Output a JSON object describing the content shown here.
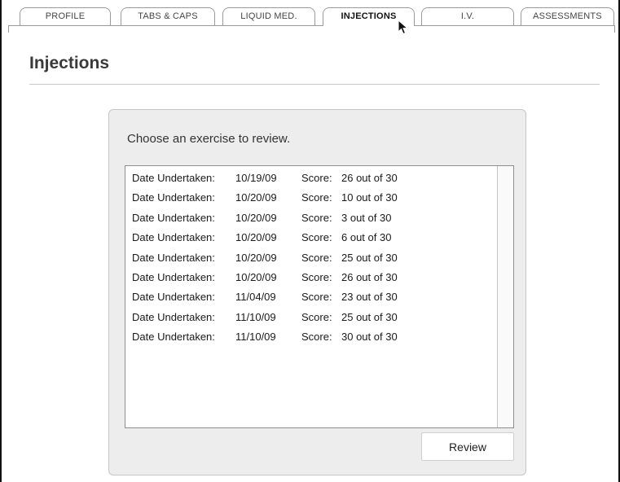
{
  "tabs": [
    {
      "label": "PROFILE",
      "active": false
    },
    {
      "label": "TABS & CAPS",
      "active": false
    },
    {
      "label": "LIQUID MED.",
      "active": false
    },
    {
      "label": "INJECTIONS",
      "active": true
    },
    {
      "label": "I.V.",
      "active": false
    },
    {
      "label": "ASSESSMENTS",
      "active": false
    }
  ],
  "page": {
    "title": "Injections"
  },
  "panel": {
    "prompt": "Choose an exercise to review.",
    "review_label": "Review"
  },
  "exercises": {
    "date_label": "Date Undertaken:",
    "score_label": "Score:",
    "items": [
      {
        "date": "10/19/09",
        "score": "26 out of 30"
      },
      {
        "date": "10/20/09",
        "score": "10 out of 30"
      },
      {
        "date": "10/20/09",
        "score": "3 out of 30"
      },
      {
        "date": "10/20/09",
        "score": "6 out of 30"
      },
      {
        "date": "10/20/09",
        "score": "25 out of 30"
      },
      {
        "date": "10/20/09",
        "score": "26 out of 30"
      },
      {
        "date": "11/04/09",
        "score": "23 out of 30"
      },
      {
        "date": "11/10/09",
        "score": "25 out of 30"
      },
      {
        "date": "11/10/09",
        "score": "30 out of 30"
      }
    ]
  },
  "cursor_icon": "arrow-cursor-icon"
}
